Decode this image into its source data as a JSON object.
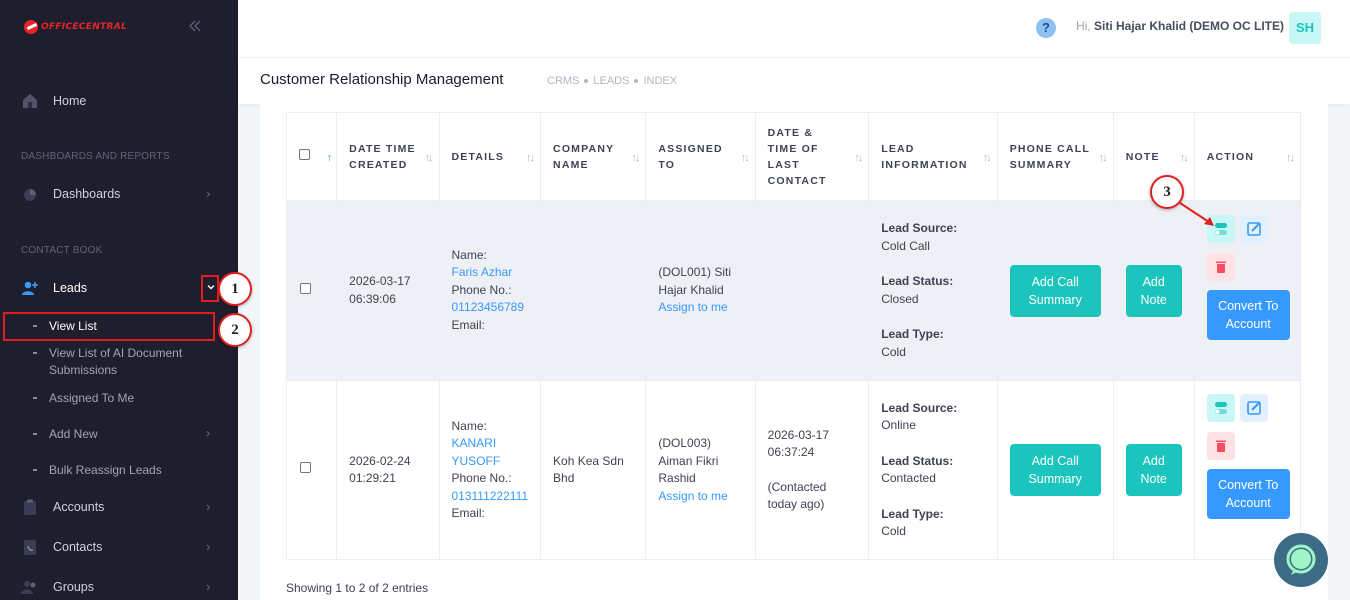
{
  "brand": {
    "name": "OFFICECENTRAL"
  },
  "sidebar": {
    "collapse_icon": "double-chevron-left-icon",
    "home": "Home",
    "section_dashboards": "DASHBOARDS AND REPORTS",
    "dashboards": "Dashboards",
    "section_contact": "CONTACT BOOK",
    "leads": "Leads",
    "leads_sub": [
      "View List",
      "View List of AI Document Submissions",
      "Assigned To Me",
      "Add New",
      "Bulk Reassign Leads"
    ],
    "accounts": "Accounts",
    "contacts": "Contacts",
    "groups": "Groups"
  },
  "callouts": [
    "1",
    "2",
    "3"
  ],
  "topbar": {
    "greeting_prefix": "Hi, ",
    "user_name": "Siti Hajar Khalid (DEMO OC LITE)",
    "avatar_initials": "SH",
    "help_label": "?"
  },
  "subheader": {
    "title": "Customer Relationship Management",
    "breadcrumb": [
      "CRMS",
      "LEADS",
      "INDEX"
    ]
  },
  "table": {
    "columns": [
      "DATE TIME CREATED",
      "DETAILS",
      "COMPANY NAME",
      "ASSIGNED TO",
      "DATE & TIME OF LAST CONTACT",
      "LEAD INFORMATION",
      "PHONE CALL SUMMARY",
      "NOTE",
      "ACTION"
    ],
    "rows": [
      {
        "created_date": "2026-03-17",
        "created_time": "06:39:06",
        "name_label": "Name:",
        "name": "Faris Azhar",
        "phone_label": "Phone No.:",
        "phone": "01123456789",
        "email_label": "Email:",
        "company": "",
        "assigned": "(DOL001) Siti Hajar Khalid",
        "assign_link": "Assign to me",
        "last_contact_date": "",
        "last_contact_time": "",
        "last_contact_note": "",
        "lead_source_label": "Lead Source:",
        "lead_source": "Cold Call",
        "lead_status_label": "Lead Status:",
        "lead_status": "Closed",
        "lead_type_label": "Lead Type:",
        "lead_type": "Cold",
        "call_btn": "Add Call Summary",
        "note_btn": "Add Note",
        "convert_btn": "Convert To Account"
      },
      {
        "created_date": "2026-02-24",
        "created_time": "01:29:21",
        "name_label": "Name:",
        "name": "KANARI YUSOFF",
        "phone_label": "Phone No.:",
        "phone": "013111222111",
        "email_label": "Email:",
        "company": "Koh Kea Sdn Bhd",
        "assigned": "(DOL003) Aiman Fikri Rashid",
        "assign_link": "Assign to me",
        "last_contact_date": "2026-03-17",
        "last_contact_time": "06:37:24",
        "last_contact_note": "(Contacted today ago)",
        "lead_source_label": "Lead Source:",
        "lead_source": "Online",
        "lead_status_label": "Lead Status:",
        "lead_status": "Contacted",
        "lead_type_label": "Lead Type:",
        "lead_type": "Cold",
        "call_btn": "Add Call Summary",
        "note_btn": "Add Note",
        "convert_btn": "Convert To Account"
      }
    ]
  },
  "footer": {
    "info": "Showing 1 to 2 of 2 entries"
  },
  "colors": {
    "sidebar_bg": "#1e1e2d",
    "primary": "#3699ff",
    "success": "#1bc5bd",
    "danger": "#f64e60",
    "callout": "#e02020"
  }
}
